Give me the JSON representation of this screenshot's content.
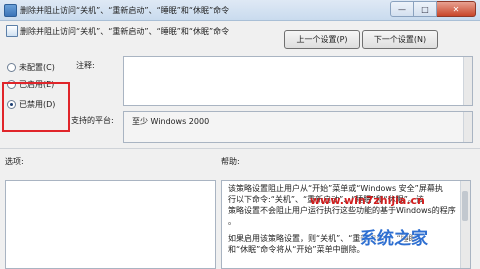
{
  "window": {
    "title": "删除并阻止访问“关机”、“重新启动”、“睡眠”和“休眠”命令",
    "minimize": "—",
    "maximize": "□",
    "close": "✕"
  },
  "header": {
    "policy_name": "删除并阻止访问“关机”、“重新启动”、“睡眠”和“休眠”命令",
    "prev_button": "上一个设置(P)",
    "next_button": "下一个设置(N)"
  },
  "state_options": [
    {
      "label": "未配置(C)",
      "checked": false
    },
    {
      "label": "已启用(E)",
      "checked": false
    },
    {
      "label": "已禁用(D)",
      "checked": true
    }
  ],
  "comment": {
    "label": "注释:",
    "value": ""
  },
  "platform": {
    "label": "支持的平台:",
    "value": "至少 Windows 2000"
  },
  "options": {
    "label": "选项:"
  },
  "help": {
    "label": "帮助:",
    "p1_line1": "该策略设置阻止用户从“开始”菜单或“Windows 安全”屏幕执",
    "p1_line2": "行以下命令:“关机”、“重新启动”、“睡眠”和“休眠”。该",
    "p1_line3": "策略设置不会阻止用户运行执行这些功能的基于Windows的程序",
    "p1_line4": "。",
    "p2_line1": "如果启用该策略设置，则“关机”、“重新启动”、“睡眠”",
    "p2_line2": "和“休眠”命令将从“开始”菜单中删除。"
  },
  "watermark": {
    "url": "www.win7zhijia.cn",
    "brand": "系统之家"
  },
  "colors": {
    "highlight": "#e0252a",
    "watermark_red": "#d21e1e",
    "watermark_blue": "#2e6fd1"
  }
}
